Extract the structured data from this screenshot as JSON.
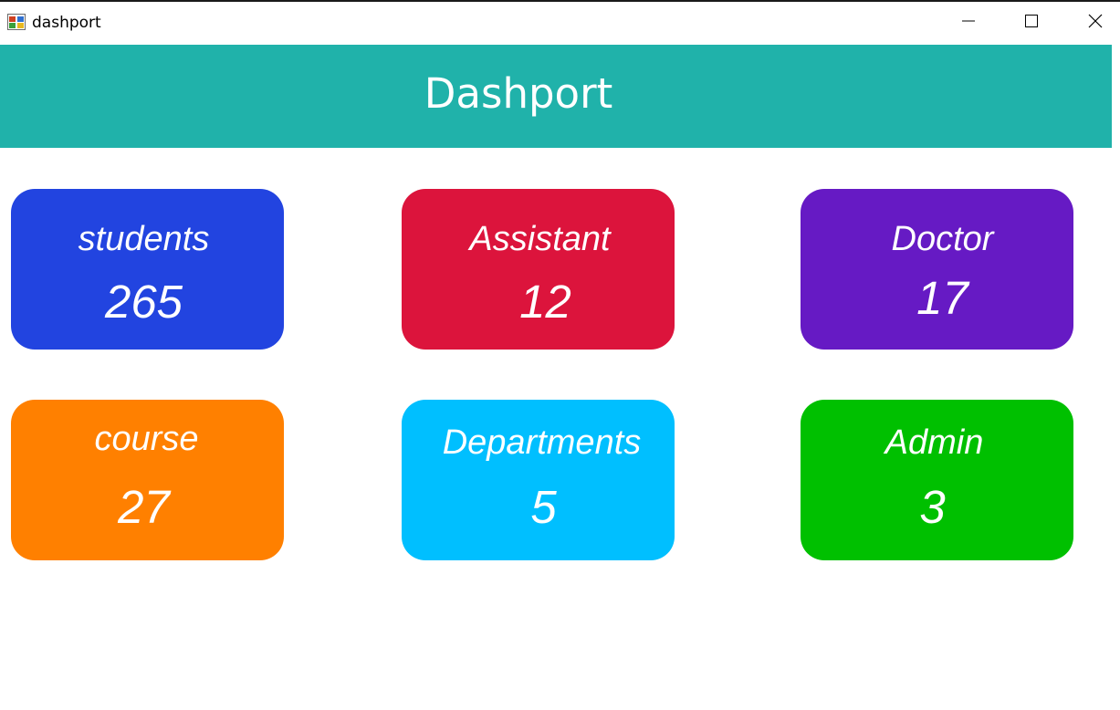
{
  "window": {
    "title": "dashport",
    "icon": "app-window-icon",
    "controls": [
      "minimize-icon",
      "maximize-icon",
      "close-icon"
    ]
  },
  "header": {
    "title": "Dashport",
    "color": "#20b2aa"
  },
  "cards": [
    {
      "label": "students",
      "count": "265",
      "color": "#2244e0"
    },
    {
      "label": "Assistant",
      "count": "12",
      "color": "#dc143c"
    },
    {
      "label": "Doctor",
      "count": "17",
      "color": "#661ac4"
    },
    {
      "label": "course",
      "count": "27",
      "color": "#ff8000"
    },
    {
      "label": "Departments",
      "count": "5",
      "color": "#00bfff"
    },
    {
      "label": "Admin",
      "count": "3",
      "color": "#00c000"
    }
  ]
}
